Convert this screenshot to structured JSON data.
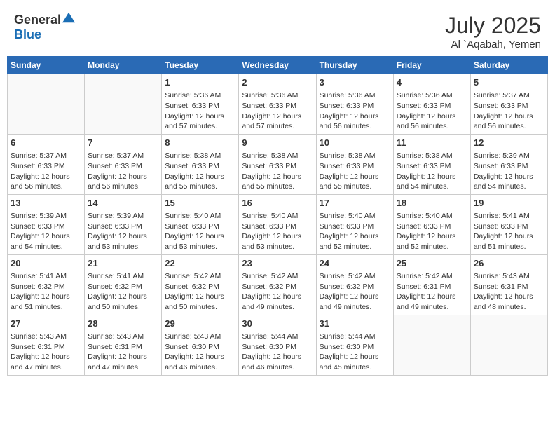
{
  "header": {
    "logo_general": "General",
    "logo_blue": "Blue",
    "month_year": "July 2025",
    "location": "Al `Aqabah, Yemen"
  },
  "days_of_week": [
    "Sunday",
    "Monday",
    "Tuesday",
    "Wednesday",
    "Thursday",
    "Friday",
    "Saturday"
  ],
  "weeks": [
    [
      {
        "day": "",
        "sunrise": "",
        "sunset": "",
        "daylight": ""
      },
      {
        "day": "",
        "sunrise": "",
        "sunset": "",
        "daylight": ""
      },
      {
        "day": "1",
        "sunrise": "Sunrise: 5:36 AM",
        "sunset": "Sunset: 6:33 PM",
        "daylight": "Daylight: 12 hours and 57 minutes."
      },
      {
        "day": "2",
        "sunrise": "Sunrise: 5:36 AM",
        "sunset": "Sunset: 6:33 PM",
        "daylight": "Daylight: 12 hours and 57 minutes."
      },
      {
        "day": "3",
        "sunrise": "Sunrise: 5:36 AM",
        "sunset": "Sunset: 6:33 PM",
        "daylight": "Daylight: 12 hours and 56 minutes."
      },
      {
        "day": "4",
        "sunrise": "Sunrise: 5:36 AM",
        "sunset": "Sunset: 6:33 PM",
        "daylight": "Daylight: 12 hours and 56 minutes."
      },
      {
        "day": "5",
        "sunrise": "Sunrise: 5:37 AM",
        "sunset": "Sunset: 6:33 PM",
        "daylight": "Daylight: 12 hours and 56 minutes."
      }
    ],
    [
      {
        "day": "6",
        "sunrise": "Sunrise: 5:37 AM",
        "sunset": "Sunset: 6:33 PM",
        "daylight": "Daylight: 12 hours and 56 minutes."
      },
      {
        "day": "7",
        "sunrise": "Sunrise: 5:37 AM",
        "sunset": "Sunset: 6:33 PM",
        "daylight": "Daylight: 12 hours and 56 minutes."
      },
      {
        "day": "8",
        "sunrise": "Sunrise: 5:38 AM",
        "sunset": "Sunset: 6:33 PM",
        "daylight": "Daylight: 12 hours and 55 minutes."
      },
      {
        "day": "9",
        "sunrise": "Sunrise: 5:38 AM",
        "sunset": "Sunset: 6:33 PM",
        "daylight": "Daylight: 12 hours and 55 minutes."
      },
      {
        "day": "10",
        "sunrise": "Sunrise: 5:38 AM",
        "sunset": "Sunset: 6:33 PM",
        "daylight": "Daylight: 12 hours and 55 minutes."
      },
      {
        "day": "11",
        "sunrise": "Sunrise: 5:38 AM",
        "sunset": "Sunset: 6:33 PM",
        "daylight": "Daylight: 12 hours and 54 minutes."
      },
      {
        "day": "12",
        "sunrise": "Sunrise: 5:39 AM",
        "sunset": "Sunset: 6:33 PM",
        "daylight": "Daylight: 12 hours and 54 minutes."
      }
    ],
    [
      {
        "day": "13",
        "sunrise": "Sunrise: 5:39 AM",
        "sunset": "Sunset: 6:33 PM",
        "daylight": "Daylight: 12 hours and 54 minutes."
      },
      {
        "day": "14",
        "sunrise": "Sunrise: 5:39 AM",
        "sunset": "Sunset: 6:33 PM",
        "daylight": "Daylight: 12 hours and 53 minutes."
      },
      {
        "day": "15",
        "sunrise": "Sunrise: 5:40 AM",
        "sunset": "Sunset: 6:33 PM",
        "daylight": "Daylight: 12 hours and 53 minutes."
      },
      {
        "day": "16",
        "sunrise": "Sunrise: 5:40 AM",
        "sunset": "Sunset: 6:33 PM",
        "daylight": "Daylight: 12 hours and 53 minutes."
      },
      {
        "day": "17",
        "sunrise": "Sunrise: 5:40 AM",
        "sunset": "Sunset: 6:33 PM",
        "daylight": "Daylight: 12 hours and 52 minutes."
      },
      {
        "day": "18",
        "sunrise": "Sunrise: 5:40 AM",
        "sunset": "Sunset: 6:33 PM",
        "daylight": "Daylight: 12 hours and 52 minutes."
      },
      {
        "day": "19",
        "sunrise": "Sunrise: 5:41 AM",
        "sunset": "Sunset: 6:33 PM",
        "daylight": "Daylight: 12 hours and 51 minutes."
      }
    ],
    [
      {
        "day": "20",
        "sunrise": "Sunrise: 5:41 AM",
        "sunset": "Sunset: 6:32 PM",
        "daylight": "Daylight: 12 hours and 51 minutes."
      },
      {
        "day": "21",
        "sunrise": "Sunrise: 5:41 AM",
        "sunset": "Sunset: 6:32 PM",
        "daylight": "Daylight: 12 hours and 50 minutes."
      },
      {
        "day": "22",
        "sunrise": "Sunrise: 5:42 AM",
        "sunset": "Sunset: 6:32 PM",
        "daylight": "Daylight: 12 hours and 50 minutes."
      },
      {
        "day": "23",
        "sunrise": "Sunrise: 5:42 AM",
        "sunset": "Sunset: 6:32 PM",
        "daylight": "Daylight: 12 hours and 49 minutes."
      },
      {
        "day": "24",
        "sunrise": "Sunrise: 5:42 AM",
        "sunset": "Sunset: 6:32 PM",
        "daylight": "Daylight: 12 hours and 49 minutes."
      },
      {
        "day": "25",
        "sunrise": "Sunrise: 5:42 AM",
        "sunset": "Sunset: 6:31 PM",
        "daylight": "Daylight: 12 hours and 49 minutes."
      },
      {
        "day": "26",
        "sunrise": "Sunrise: 5:43 AM",
        "sunset": "Sunset: 6:31 PM",
        "daylight": "Daylight: 12 hours and 48 minutes."
      }
    ],
    [
      {
        "day": "27",
        "sunrise": "Sunrise: 5:43 AM",
        "sunset": "Sunset: 6:31 PM",
        "daylight": "Daylight: 12 hours and 47 minutes."
      },
      {
        "day": "28",
        "sunrise": "Sunrise: 5:43 AM",
        "sunset": "Sunset: 6:31 PM",
        "daylight": "Daylight: 12 hours and 47 minutes."
      },
      {
        "day": "29",
        "sunrise": "Sunrise: 5:43 AM",
        "sunset": "Sunset: 6:30 PM",
        "daylight": "Daylight: 12 hours and 46 minutes."
      },
      {
        "day": "30",
        "sunrise": "Sunrise: 5:44 AM",
        "sunset": "Sunset: 6:30 PM",
        "daylight": "Daylight: 12 hours and 46 minutes."
      },
      {
        "day": "31",
        "sunrise": "Sunrise: 5:44 AM",
        "sunset": "Sunset: 6:30 PM",
        "daylight": "Daylight: 12 hours and 45 minutes."
      },
      {
        "day": "",
        "sunrise": "",
        "sunset": "",
        "daylight": ""
      },
      {
        "day": "",
        "sunrise": "",
        "sunset": "",
        "daylight": ""
      }
    ]
  ]
}
